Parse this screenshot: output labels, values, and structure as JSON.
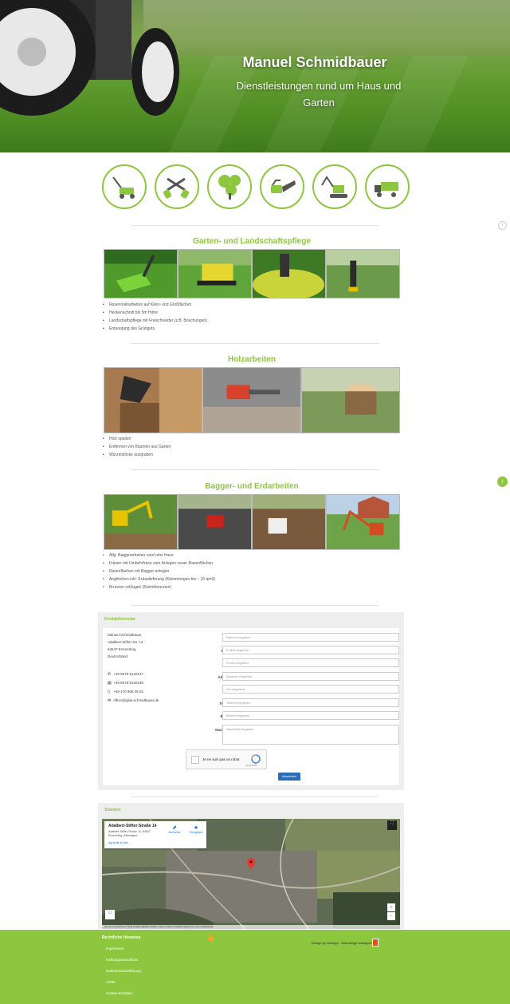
{
  "hero": {
    "title": "Manuel Schmidbauer",
    "subtitle": "Dienstleistungen rund um Haus und Garten"
  },
  "services": {
    "icons": [
      "lawnmower-icon",
      "hedge-shears-icon",
      "trees-icon",
      "chainsaw-icon",
      "excavator-icon",
      "dump-truck-icon"
    ]
  },
  "sections": [
    {
      "title": "Garten- und Landschaftspflege",
      "bullets": [
        "Rasenmäharbeiten auf Klein- und Großflächen",
        "Heckenschnitt bis 5m Höhe",
        "Landschaftspflege mit Freischneider (z.B. Böschungen)",
        "Entsorgung des Grünguts"
      ]
    },
    {
      "title": "Holzarbeiten",
      "bullets": [
        "Holz spalten",
        "Entfernen von Bäumen aus Gärten",
        "Wurzelstöcke ausgraben"
      ]
    },
    {
      "title": "Bagger- und Erdarbeiten",
      "bullets": [
        "Allg. Baggerarbeiten rund ums Haus",
        "Fräsen mit Umkehrfräse zum Anlegen neuer Rasenflächen",
        "Rasenflächen mit Bagger anlegen",
        "Angleichen inkl. Erdanlieferung (Kleinmengen bis ~ 10 qm3)",
        "Brunnen schlagen (Rammbrunnen)"
      ]
    }
  ],
  "contact": {
    "header": "Kontaktformular",
    "address": {
      "name": "Manuel Schmidbauer",
      "street": "Adalbert-Stifter-Str. 14",
      "city": "84547 Emmerting",
      "country": "Deutschland"
    },
    "phone": "+49 8679 9140137",
    "fax": "+49 8679 9140138",
    "mobile": "+49 170 966 05 53",
    "email": "office@gala-schmidbauer.de",
    "fields": [
      {
        "label": "Name",
        "placeholder": "Namen eingeben"
      },
      {
        "label": "E-Mail",
        "placeholder": "E-Mail angeben"
      },
      {
        "label": "Firma",
        "placeholder": "Firma eingeben"
      },
      {
        "label": "Adresse",
        "placeholder": "Adresse eingeben"
      },
      {
        "label": "Ort",
        "placeholder": "Ort eingeben"
      },
      {
        "label": "Telefon",
        "placeholder": "Telefon eingeben"
      },
      {
        "label": "Betreff",
        "placeholder": "Betreff eingeben"
      },
      {
        "label": "Nachricht",
        "placeholder": "Nachricht eingeben"
      }
    ],
    "recaptcha_label": "Je ne suis pas un robot",
    "recaptcha_small": "reCAPTCHA",
    "submit_label": "Absenden"
  },
  "map": {
    "header": "Standort",
    "card_title": "Adalbert-Stifter-Straße 14",
    "card_address": "Adalbert-Stifter-Straße 14, 84547 Emmerting, Allemagne",
    "card_link": "Agrandir le plan",
    "directions_label": "Itinéraires",
    "save_label": "Enregistrer",
    "zoom_in": "+",
    "zoom_out": "−",
    "attribution": "Données cartographiques ©2019 GeoBasis-DE/BKG (©2009), Google  Conditions d'utilisation  Signaler une erreur cartographique"
  },
  "footer": {
    "heading": "Rechtliche Hinweise",
    "links": [
      "Impressum",
      "Haftungsausschluss",
      "Datenschutzerklärung",
      "AGBs",
      "Cookie-Richtlinie"
    ],
    "design_credit": "Design by Webego - Webdesign Ostbayern"
  },
  "colors": {
    "accent": "#8dc63f",
    "button": "#2c6fb7"
  }
}
